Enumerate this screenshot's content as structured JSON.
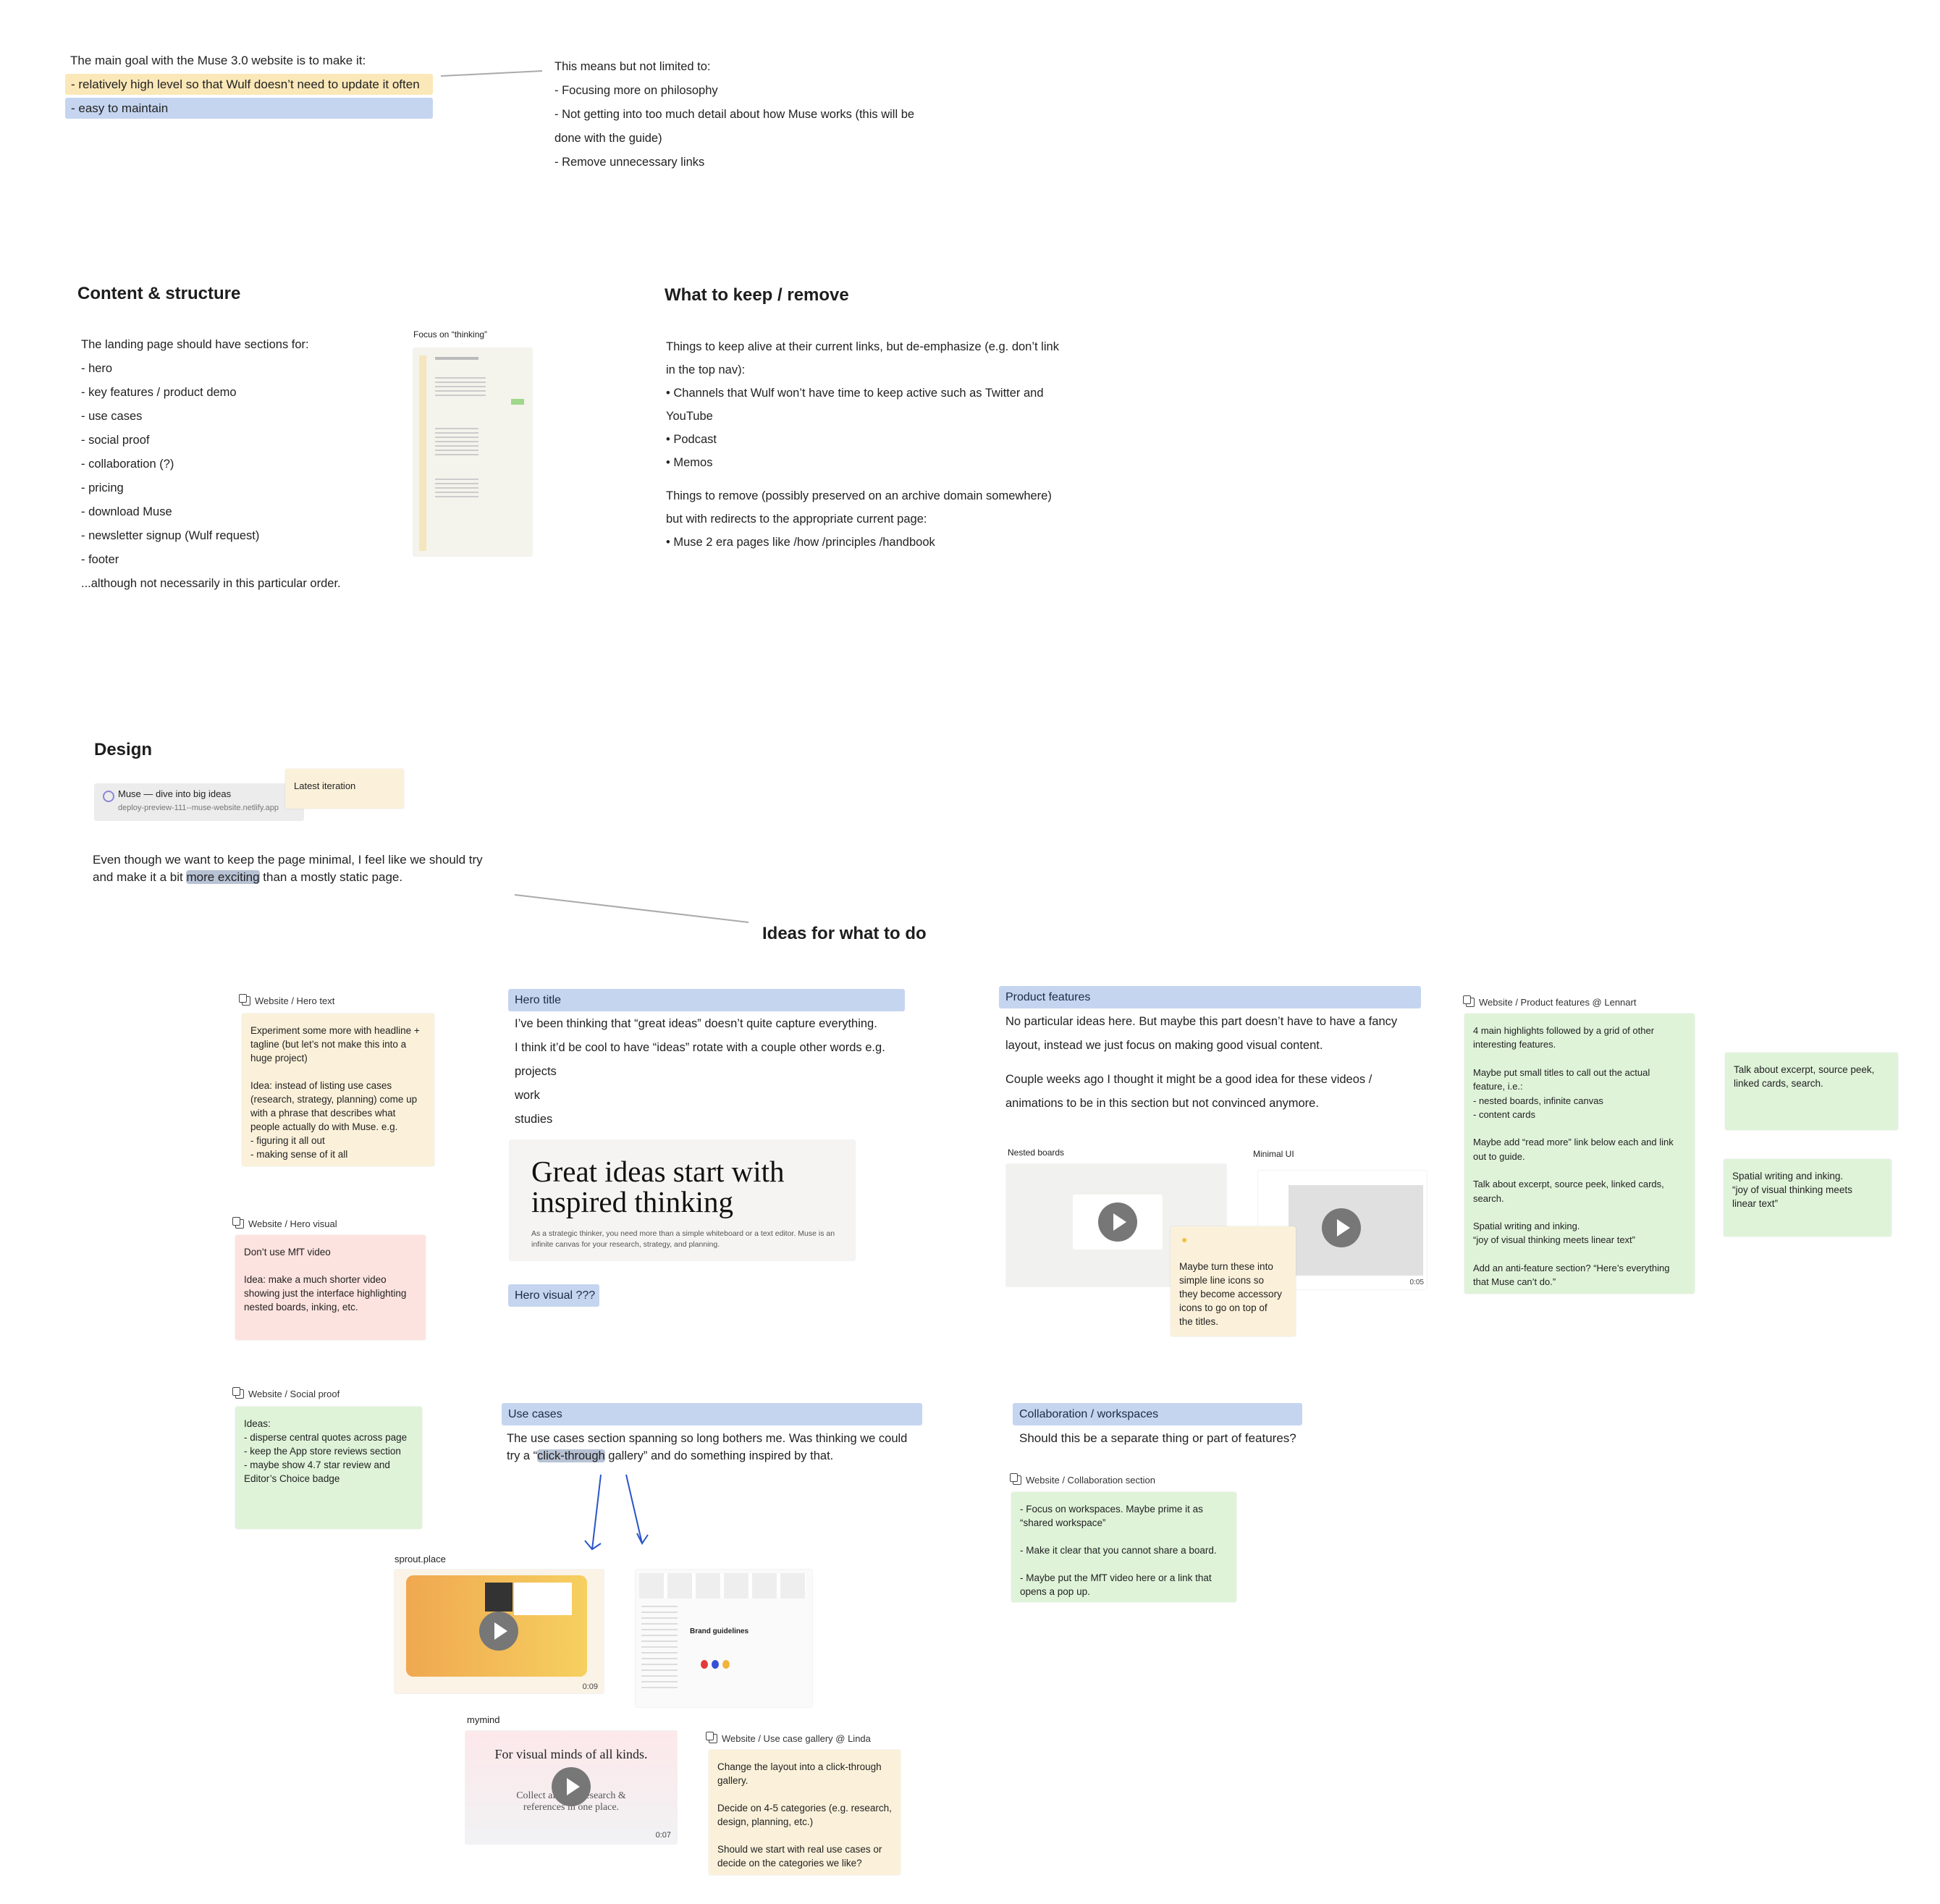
{
  "goal": {
    "intro": "The main goal with the Muse 3.0 website is to make it:",
    "items": [
      "- relatively high level so that Wulf doesn’t need to update it often",
      "- easy to maintain"
    ],
    "highlight_colors": [
      "#fbe8b8",
      "#c5d5f0"
    ]
  },
  "means": {
    "lines": [
      "This means but not limited to:",
      "- Focusing more on philosophy",
      "- Not getting into too much detail about how Muse works (this will be",
      "done with the guide)",
      "- Remove unnecessary links"
    ]
  },
  "content": {
    "title": "Content & structure",
    "lines": [
      "The landing page should have sections for:",
      "- hero",
      "- key features / product demo",
      "- use cases",
      "- social proof",
      "- collaboration (?)",
      "- pricing",
      "- download Muse",
      "- newsletter signup (Wulf request)",
      "- footer",
      "",
      "...although not necessarily in this particular order."
    ],
    "thumb_label": "Focus on “thinking”"
  },
  "keep": {
    "title": "What to keep / remove",
    "lines": [
      "Things to keep alive at their current links, but de-emphasize (e.g. don’t link",
      "in the top nav):",
      "• Channels that Wulf won’t have time to keep active such as Twitter and",
      "YouTube",
      "• Podcast",
      "• Memos",
      "",
      "Things to remove (possibly preserved on an archive domain somewhere)",
      "but with redirects to the appropriate current page:",
      "• Muse 2 era pages like /how /principles /handbook"
    ]
  },
  "design": {
    "title": "Design",
    "link_title": "Muse — dive into big ideas",
    "link_url": "deploy-preview-111--muse-website.netlify.app",
    "latest": "Latest iteration",
    "text_before": "Even though we want to keep the page minimal, I feel like we should try",
    "text_line2_before": "and make it a bit ",
    "text_highlight": "more exciting",
    "text_after": " than a mostly static page."
  },
  "ideas": {
    "title": "Ideas for what to do",
    "hero_text": {
      "label": "Website / Hero text",
      "lines": [
        "Experiment some more with headline +",
        "tagline (but let’s not make this into a",
        "huge project)",
        "",
        "Idea: instead of listing use cases",
        "(research, strategy, planning) come up",
        "with a phrase that describes what",
        "people actually do with Muse. e.g.",
        "- figuring it all out",
        "- making sense of it all"
      ]
    },
    "hero_visual": {
      "label": "Website / Hero visual",
      "lines": [
        "Don’t use MfT video",
        "",
        "Idea: make a much shorter video",
        "showing just the interface highlighting",
        "nested boards, inking, etc."
      ]
    },
    "social_proof": {
      "label": "Website / Social proof",
      "lines": [
        "Ideas:",
        "- disperse central quotes across page",
        "- keep the App store reviews section",
        "- maybe show 4.7 star review and",
        "Editor’s Choice badge"
      ]
    },
    "hero_title": {
      "bar": "Hero title",
      "lines": [
        "I’ve been thinking that “great ideas” doesn’t quite capture everything.",
        "I think it’d be cool to have “ideas” rotate with a couple other words e.g.",
        "projects",
        "work",
        "studies"
      ],
      "card_headline": "Great ideas start with inspired thinking",
      "card_sub": "As a strategic thinker, you need more than a simple whiteboard or a text editor. Muse is an infinite canvas for your research, strategy, and planning.",
      "visual_badge": "Hero visual ???"
    },
    "use_cases": {
      "bar": "Use cases",
      "line1": "The use cases section spanning so long bothers me. Was thinking we could",
      "line2_before": "try a “",
      "line2_highlight": "click-through",
      "line2_after": " gallery” and do something inspired by that.",
      "sprout_label": "sprout.place",
      "sprout_time": "0:09",
      "brand_title": "Brand guidelines",
      "mymind_label": "mymind",
      "mymind_headline": "For visual minds of all kinds.",
      "mymind_sub": "Collect all your research & references in one place.",
      "mymind_time": "0:07"
    },
    "gallery": {
      "label": "Website / Use case gallery @ Linda",
      "lines": [
        "Change the layout into a click-through",
        "gallery.",
        "",
        "Decide on 4-5 categories (e.g. research,",
        "design, planning, etc.)",
        "",
        "Should we start with real use cases or",
        "decide on the categories we like?"
      ]
    },
    "product": {
      "bar": "Product features",
      "lines": [
        "No particular ideas here. But maybe this part doesn’t have to have a fancy",
        "layout, instead we just focus on making good visual content.",
        "",
        "Couple weeks ago I thought it might be a good idea for these videos /",
        "animations to be in this section but not convinced anymore."
      ],
      "nested_label": "Nested boards",
      "minimal_label": "Minimal UI",
      "minimal_time": "0:05",
      "icon_note": [
        "Maybe turn these into",
        "simple line icons so",
        "they become accessory",
        "icons to go on top of",
        "the titles."
      ]
    },
    "lennart": {
      "label": "Website / Product features @ Lennart",
      "lines": [
        "4 main highlights followed by a grid of other",
        "interesting features.",
        "",
        "Maybe put small titles to call out the actual",
        "feature, i.e.:",
        "- nested boards, infinite canvas",
        "- content cards",
        "",
        "Maybe add “read more” link below each and link",
        "out to guide.",
        "",
        "Talk about excerpt, source peek, linked cards,",
        "search.",
        "",
        "Spatial writing and inking.",
        "“joy of visual thinking meets linear text”",
        "",
        "Add an anti-feature section? “Here’s everything",
        "that Muse can’t do.”"
      ]
    },
    "talk_note": {
      "lines": [
        "Talk about excerpt, source peek,",
        "linked cards, search."
      ]
    },
    "spatial_note": {
      "lines": [
        "Spatial writing and inking.",
        "“joy of visual thinking meets",
        "linear text”"
      ]
    },
    "collab": {
      "bar": "Collaboration / workspaces",
      "text": "Should this be a separate thing or part of features?",
      "label": "Website / Collaboration section",
      "lines": [
        "- Focus on workspaces. Maybe prime it as",
        "“shared workspace”",
        "",
        "- Make it clear that you cannot share a board.",
        "",
        "- Maybe put the MfT video here or a link that",
        "opens a pop up."
      ]
    }
  },
  "colors": {
    "yellow_note": "#fbf1da",
    "pink_note": "#fde3df",
    "green_note": "#dff3d9",
    "blue_bar": "#c5d5f0",
    "arrow": "#2a55c8"
  }
}
